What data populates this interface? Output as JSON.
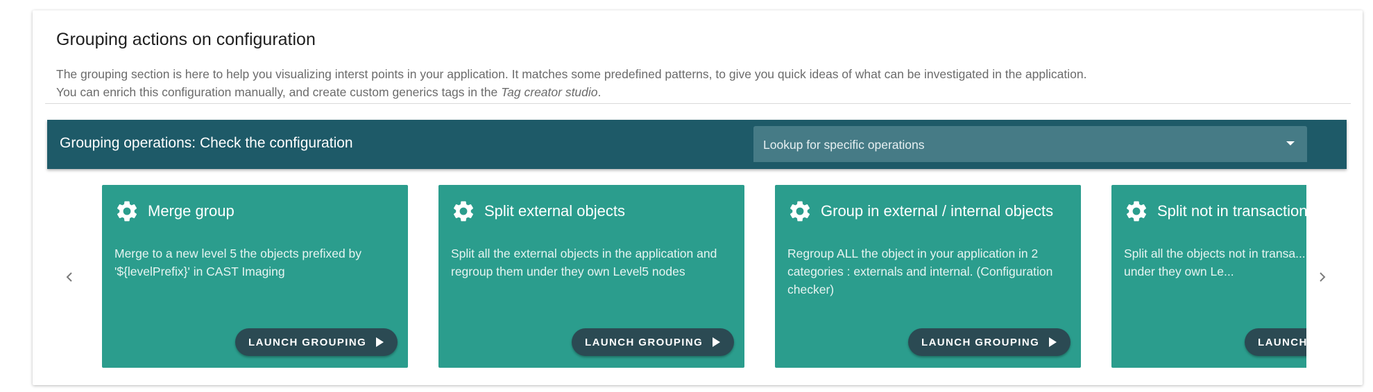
{
  "section": {
    "title": "Grouping actions on configuration",
    "description_line1": "The grouping section is here to help you visualizing interst points in your application. It matches some predefined patterns, to give you quick ideas of what can be investigated in the application.",
    "description_line2_prefix": "You can enrich this configuration manually, and create custom generics tags in the ",
    "description_line2_link": "Tag creator studio",
    "description_line2_suffix": "."
  },
  "toolbar": {
    "title": "Grouping operations: Check the configuration",
    "lookup_label": "Lookup for specific operations"
  },
  "carousel": {
    "prev_icon": "chevron-left-icon",
    "next_icon": "chevron-right-icon",
    "cards": [
      {
        "icon": "gear-icon",
        "title": "Merge group",
        "text": "Merge to a new level 5 the objects prefixed by '${levelPrefix}' in CAST Imaging",
        "button_label": "LAUNCH GROUPING"
      },
      {
        "icon": "gear-icon",
        "title": "Split external objects",
        "text": "Split all the external objects in the application and regroup them under they own Level5 nodes",
        "button_label": "LAUNCH GROUPING"
      },
      {
        "icon": "gear-icon",
        "title": "Group in external / internal objects",
        "text": "Regroup ALL the object in your application in 2 categories : externals and internal. (Configuration checker)",
        "button_label": "LAUNCH GROUPING"
      },
      {
        "icon": "gear-icon",
        "title": "Split not in transaction",
        "text": "Split all the objects not in transa... regroup them under they own Le...",
        "button_label": "LAUNCH GROUPING"
      }
    ]
  },
  "colors": {
    "toolbar_bg": "#1e5a68",
    "lookup_bg": "#467b86",
    "card_bg": "#2b9d8d",
    "button_bg": "#2b4a53"
  }
}
